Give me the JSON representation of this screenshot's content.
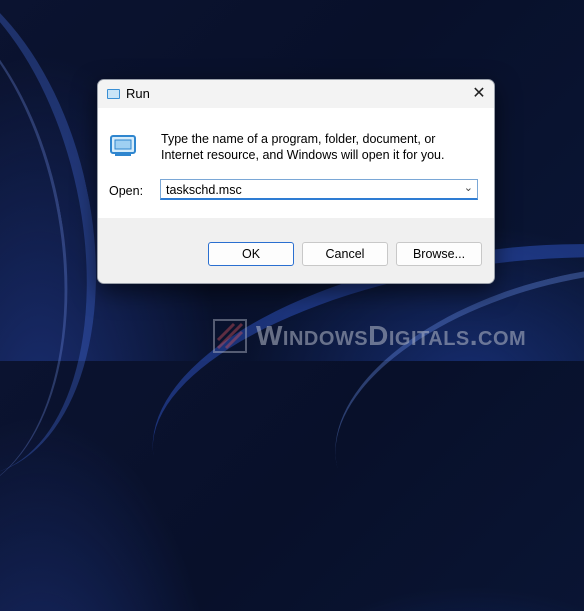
{
  "dialog": {
    "title": "Run",
    "close_glyph": "✕",
    "description": "Type the name of a program, folder, document, or Internet resource, and Windows will open it for you.",
    "open_label": "Open:",
    "open_value": "taskschd.msc",
    "dropdown_glyph": "⌄",
    "buttons": {
      "ok": "OK",
      "cancel": "Cancel",
      "browse": "Browse..."
    }
  },
  "watermark": {
    "text": "WindowsDigitals.com"
  },
  "icons": [
    "run-app-icon",
    "run-program-icon",
    "close-icon",
    "chevron-down-icon"
  ]
}
